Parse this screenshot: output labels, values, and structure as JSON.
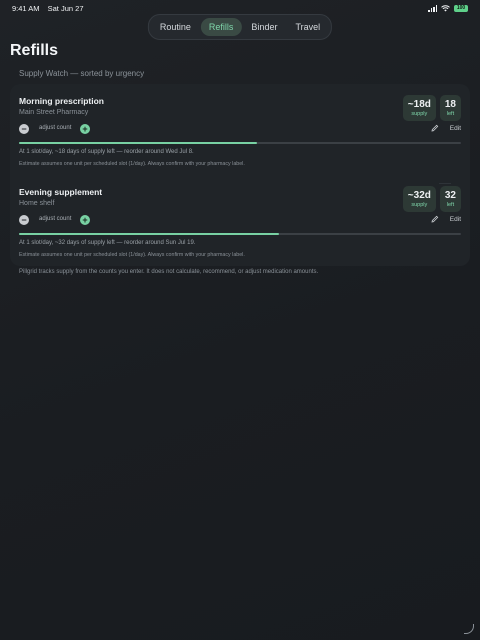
{
  "status": {
    "time": "9:41 AM",
    "date": "Sat Jun 27",
    "battery": "100"
  },
  "tabs": [
    {
      "label": "Routine",
      "active": false
    },
    {
      "label": "Refills",
      "active": true
    },
    {
      "label": "Binder",
      "active": false
    },
    {
      "label": "Travel",
      "active": false
    }
  ],
  "page": {
    "title": "Refills"
  },
  "supply_watch": {
    "title": "Supply Watch — sorted by urgency",
    "items": [
      {
        "name": "Morning prescription",
        "location": "Main Street Pharmacy",
        "supply_value": "~18d",
        "supply_label": "supply",
        "left_value": "18",
        "left_label": "left",
        "adjust_label": "adjust count",
        "edit_label": "Edit",
        "progress": 0.538,
        "note": "At 1 slot/day, ~18 days of supply left — reorder around Wed Jul 8.",
        "estimate": "Estimate assumes one unit per scheduled slot (1/day). Always confirm with your pharmacy label."
      },
      {
        "name": "Evening supplement",
        "location": "Home shelf",
        "supply_value": "~32d",
        "supply_label": "supply",
        "left_value": "32",
        "left_label": "left",
        "adjust_label": "adjust count",
        "edit_label": "Edit",
        "progress": 0.588,
        "note": "At 1 slot/day, ~32 days of supply left — reorder around Sun Jul 19.",
        "estimate": "Estimate assumes one unit per scheduled slot (1/day). Always confirm with your pharmacy label."
      }
    ]
  },
  "footer": "Pillgrid tracks supply from the counts you enter. It does not calculate, recommend, or adjust medication amounts.",
  "colors": {
    "accent": "#78d1a3",
    "background": "#1c1f23",
    "card": "#202428"
  }
}
